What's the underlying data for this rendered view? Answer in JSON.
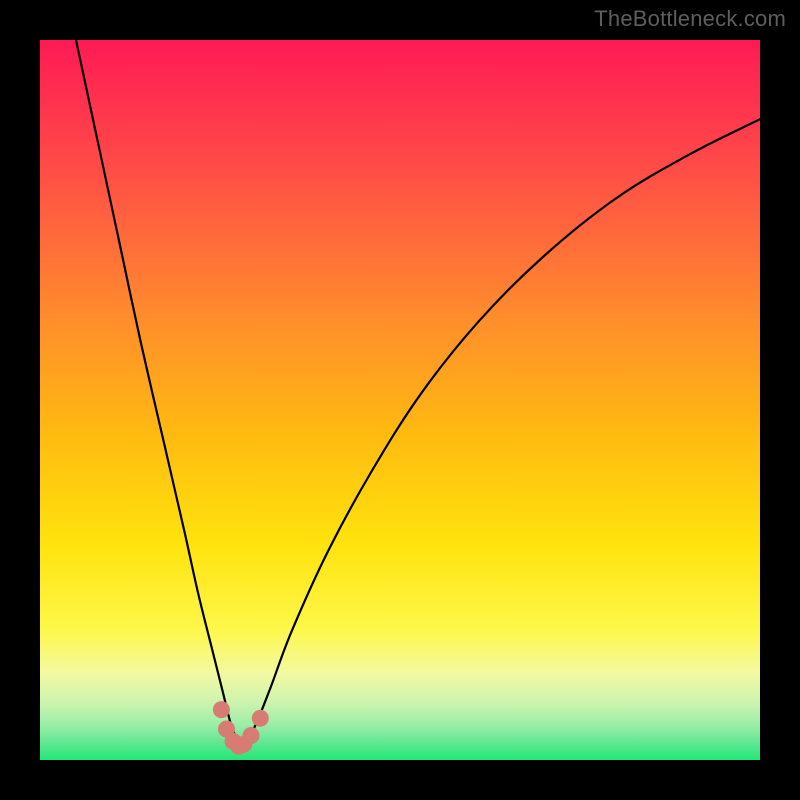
{
  "watermark": "TheBottleneck.com",
  "colors": {
    "top": "#ff1a55",
    "mid1": "#ff6a3c",
    "mid2": "#ffb108",
    "mid3": "#ffe309",
    "mid4": "#f8fa5f",
    "mid5": "#d3f79e",
    "bottom": "#23e879",
    "curve": "#000000",
    "markers": "#d77c73"
  },
  "chart_data": {
    "type": "line",
    "title": "",
    "xlabel": "",
    "ylabel": "",
    "xlim": [
      0,
      100
    ],
    "ylim": [
      0,
      100
    ],
    "series": [
      {
        "name": "bottleneck-curve",
        "x": [
          5,
          8,
          11,
          14,
          17,
          20,
          22,
          24,
          25.5,
          26.5,
          27.3,
          28,
          28.8,
          30,
          32,
          35,
          40,
          46,
          53,
          61,
          70,
          80,
          90,
          100
        ],
        "y": [
          100,
          86,
          72,
          58,
          45,
          32,
          23,
          15,
          9,
          5,
          3,
          2,
          3,
          5,
          10,
          18,
          29,
          40,
          51,
          61,
          70,
          78,
          84,
          89
        ]
      }
    ],
    "markers": {
      "name": "highlight-dots",
      "x": [
        25.2,
        25.9,
        26.8,
        27.6,
        28.3,
        29.3,
        30.6
      ],
      "y": [
        7.0,
        4.3,
        2.6,
        1.9,
        2.2,
        3.4,
        5.8
      ]
    }
  }
}
